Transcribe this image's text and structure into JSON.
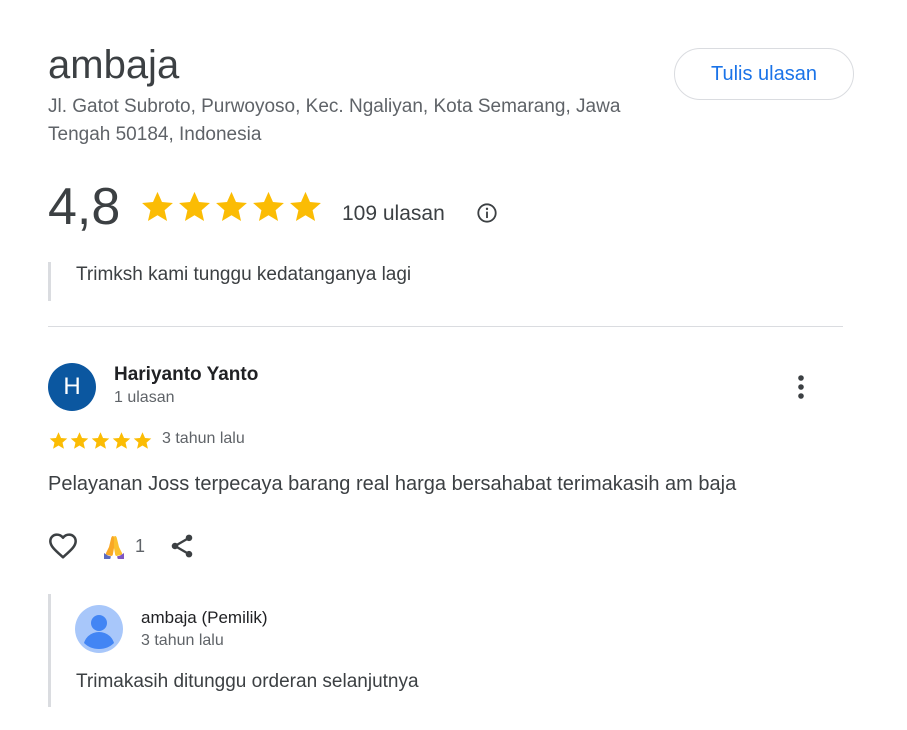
{
  "place": {
    "name": "ambaja",
    "address": "Jl. Gatot Subroto, Purwoyoso, Kec. Ngaliyan, Kota Semarang, Jawa Tengah 50184, Indonesia",
    "write_review_label": "Tulis ulasan",
    "rating": "4,8",
    "rating_value": 4.8,
    "review_count": "109 ulasan",
    "quote": "Trimksh kami tunggu kedatanganya lagi"
  },
  "review": {
    "avatar_letter": "H",
    "author": "Hariyanto Yanto",
    "author_meta": "1 ulasan",
    "stars": 5,
    "date": "3 tahun lalu",
    "text": "Pelayanan Joss terpecaya barang real harga bersahabat terimakasih am baja",
    "reaction_count": "1"
  },
  "owner_reply": {
    "author": "ambaja (Pemilik)",
    "date": "3 tahun lalu",
    "text": "Trimakasih ditunggu orderan selanjutnya"
  },
  "colors": {
    "star": "#fbbc04",
    "accent": "#1a73e8",
    "avatar_bg": "#0b57a0"
  }
}
